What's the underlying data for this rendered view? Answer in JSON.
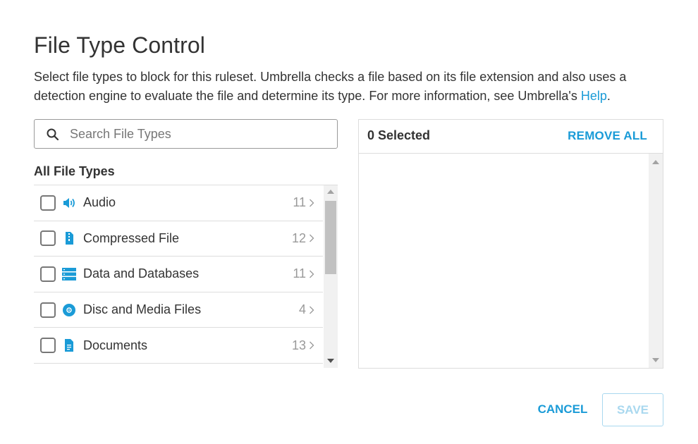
{
  "dialog": {
    "title": "File Type Control",
    "description_prefix": "Select file types to block for this ruleset. Umbrella checks a file based on its file extension and also uses a detection engine to evaluate the file and determine its type. For more information, see Umbrella's ",
    "help_link": "Help",
    "description_suffix": "."
  },
  "search": {
    "placeholder": "Search File Types",
    "value": ""
  },
  "file_types": {
    "heading": "All File Types",
    "items": [
      {
        "label": "Audio",
        "count": "11",
        "icon": "speaker-icon"
      },
      {
        "label": "Compressed File",
        "count": "12",
        "icon": "compressed-file-icon"
      },
      {
        "label": "Data and Databases",
        "count": "11",
        "icon": "database-icon"
      },
      {
        "label": "Disc and Media Files",
        "count": "4",
        "icon": "disc-icon"
      },
      {
        "label": "Documents",
        "count": "13",
        "icon": "document-icon"
      }
    ]
  },
  "selected": {
    "count_label": "0 Selected",
    "remove_all_label": "REMOVE ALL"
  },
  "footer": {
    "cancel_label": "CANCEL",
    "save_label": "SAVE"
  },
  "colors": {
    "accent": "#1a9bd7",
    "save_disabled": "#a9d8ef",
    "border": "#dddddd",
    "text": "#333333",
    "muted": "#999999"
  }
}
